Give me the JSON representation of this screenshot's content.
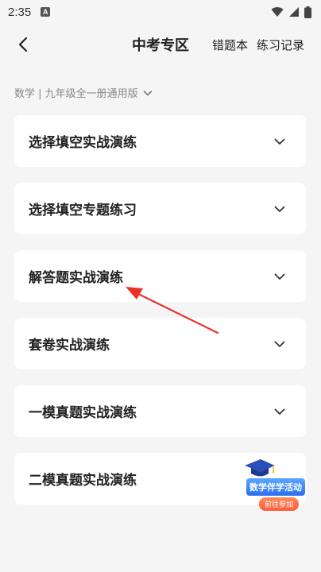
{
  "status_bar": {
    "time": "2:35",
    "notification_letter": "A"
  },
  "header": {
    "title": "中考专区",
    "wrong_book": "错题本",
    "practice_record": "练习记录"
  },
  "filter": {
    "label": "数学 | 九年级全一册通用版"
  },
  "sections": [
    {
      "label": "选择填空实战演练"
    },
    {
      "label": "选择填空专题练习"
    },
    {
      "label": "解答题实战演练"
    },
    {
      "label": "套卷实战演练"
    },
    {
      "label": "一模真题实战演练"
    },
    {
      "label": "二模真题实战演练"
    }
  ],
  "promo": {
    "title": "数学伴学活动",
    "button": "前往参加"
  },
  "colors": {
    "background": "#f5f5f5",
    "card": "#ffffff",
    "arrow": "#e8322c",
    "promo_blue": "#2b6ef2",
    "promo_orange": "#ff5a3a"
  }
}
